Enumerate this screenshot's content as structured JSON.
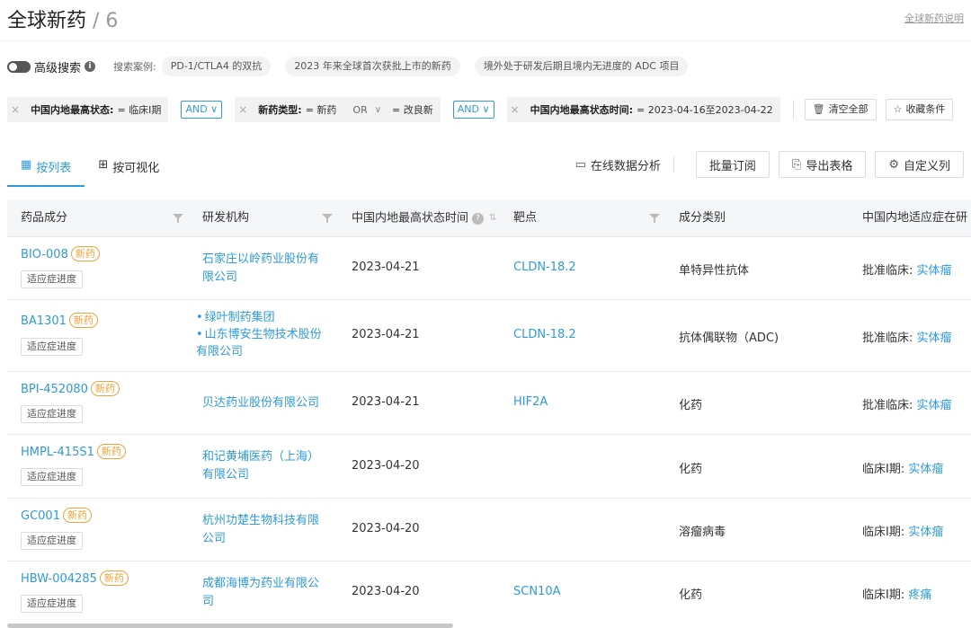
{
  "header": {
    "title": "全球新药",
    "count": "/ 6",
    "help_link": "全球新药说明"
  },
  "search": {
    "advanced_label": "高级搜索",
    "examples_label": "搜索案例:",
    "examples": [
      "PD-1/CTLA4 的双抗",
      "2023 年来全球首次获批上市的新药",
      "境外处于研发后期且境内无进度的 ADC 项目"
    ]
  },
  "filters": {
    "f1_key": "中国内地最高状态:",
    "f1_val": "= 临床I期",
    "and1": "AND ∨",
    "f2_key": "新药类型:",
    "f2_val1": "= 新药",
    "f2_or": "OR",
    "f2_caret": "∨",
    "f2_val2": "= 改良新",
    "and2": "AND ∨",
    "f3_key": "中国内地最高状态时间:",
    "f3_val": "= 2023-04-16至2023-04-22",
    "clear_label": "清空全部",
    "save_label": "收藏条件"
  },
  "tabs": {
    "list_label": "按列表",
    "visual_label": "按可视化"
  },
  "toolbar": {
    "analysis_label": "在线数据分析",
    "subscribe_label": "批量订阅",
    "export_label": "导出表格",
    "columns_label": "自定义列"
  },
  "table": {
    "headers": {
      "drug": "药品成分",
      "org": "研发机构",
      "date": "中国内地最高状态时间",
      "target": "靶点",
      "type": "成分类别",
      "indication": "中国内地适应症在研"
    },
    "new_badge": "新药",
    "indication_button": "适应症进度",
    "rows": [
      {
        "drug": "BIO-008",
        "orgs": [
          "石家庄以岭药业股份有限公司"
        ],
        "date": "2023-04-21",
        "target": "CLDN-18.2",
        "type": "单特异性抗体",
        "ind_label": "批准临床:",
        "ind_val": "实体瘤"
      },
      {
        "drug": "BA1301",
        "orgs": [
          "绿叶制药集团",
          "山东博安生物技术股份有限公司"
        ],
        "date": "2023-04-21",
        "target": "CLDN-18.2",
        "type": "抗体偶联物（ADC)",
        "ind_label": "批准临床:",
        "ind_val": "实体瘤"
      },
      {
        "drug": "BPI-452080",
        "orgs": [
          "贝达药业股份有限公司"
        ],
        "date": "2023-04-21",
        "target": "HIF2A",
        "type": "化药",
        "ind_label": "批准临床:",
        "ind_val": "实体瘤"
      },
      {
        "drug": "HMPL-415S1",
        "orgs": [
          "和记黄埔医药（上海）有限公司"
        ],
        "date": "2023-04-20",
        "target": "",
        "type": "化药",
        "ind_label": "临床I期:",
        "ind_val": "实体瘤"
      },
      {
        "drug": "GC001",
        "orgs": [
          "杭州功楚生物科技有限公司"
        ],
        "date": "2023-04-20",
        "target": "",
        "type": "溶瘤病毒",
        "ind_label": "临床I期:",
        "ind_val": "实体瘤"
      },
      {
        "drug": "HBW-004285",
        "orgs": [
          "成都海博为药业有限公司"
        ],
        "date": "2023-04-20",
        "target": "SCN10A",
        "type": "化药",
        "ind_label": "临床I期:",
        "ind_val": "疼痛"
      }
    ]
  }
}
